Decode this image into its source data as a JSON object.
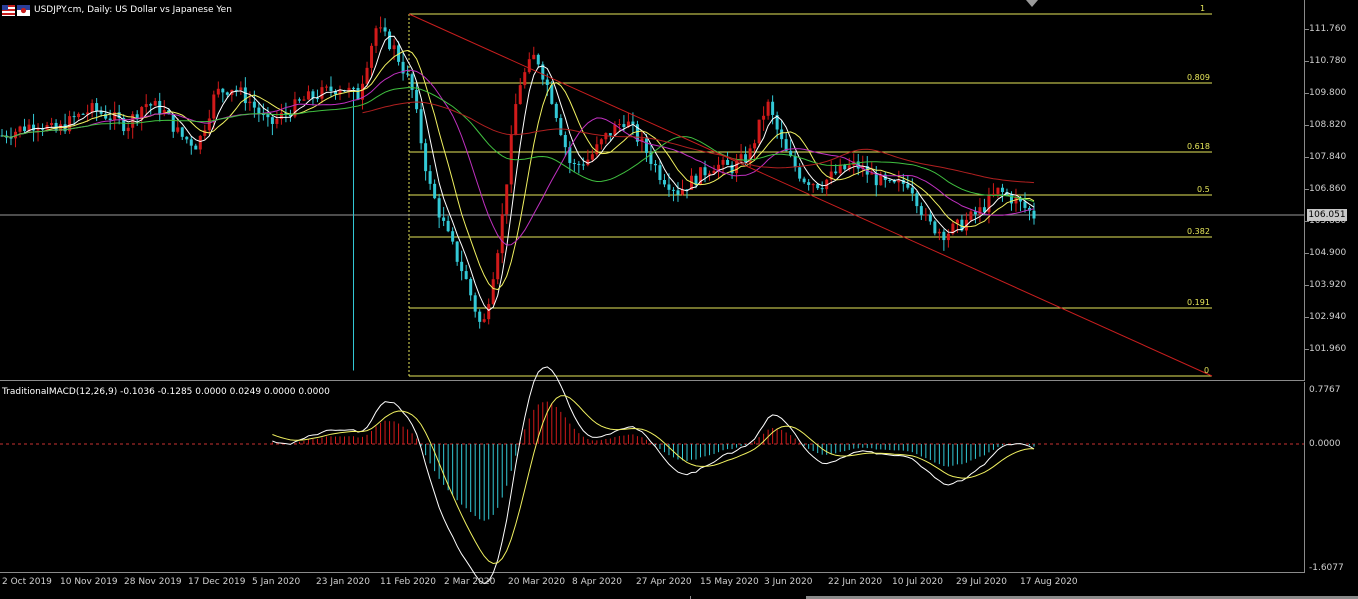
{
  "chart_title": "USDJPY.cm, Daily:  US Dollar vs Japanese Yen",
  "macd_title": "TraditionalMACD(12,26,9) -0.1036 -0.1285 0.0000 0.0249 0.0000 0.0000",
  "current_price": "106.051",
  "price_axis": [
    "111.760",
    "110.780",
    "109.800",
    "108.820",
    "107.840",
    "106.860",
    "105.880",
    "104.900",
    "103.920",
    "102.940",
    "101.960"
  ],
  "macd_axis": {
    "top": "0.7767",
    "zero": "0.0000",
    "bottom": "-1.6077"
  },
  "time_axis": [
    "2 Oct 2019",
    "10 Nov 2019",
    "28 Nov 2019",
    "17 Dec 2019",
    "5 Jan 2020",
    "23 Jan 2020",
    "11 Feb 2020",
    "2 Mar 2020",
    "20 Mar 2020",
    "8 Apr 2020",
    "27 Apr 2020",
    "15 May 2020",
    "3 Jun 2020",
    "22 Jun 2020",
    "10 Jul 2020",
    "29 Jul 2020",
    "17 Aug 2020"
  ],
  "fibo_levels": [
    "1",
    "0.809",
    "0.618",
    "0.5",
    "0.382",
    "0.191",
    "0"
  ],
  "colors": {
    "bull": "#d11a1a",
    "bear": "#33c9d6",
    "fib": "#e6e65a",
    "trend": "#c81e1e",
    "grid": "#8a8a8a",
    "ma_white": "#ffffff",
    "ma_yellow": "#f0f060",
    "ma_green": "#40c040",
    "ma_magenta": "#c030c0",
    "ma_red": "#b02020"
  },
  "icons": {
    "flag": "us-jp-flag-icon",
    "scroll": "chart-shift-marker-icon"
  },
  "chart_data": {
    "type": "candlestick",
    "symbol": "USDJPY.cm",
    "timeframe": "Daily",
    "ylim": [
      101.3,
      112.2
    ],
    "close_approx": [
      108.5,
      108.7,
      108.9,
      108.6,
      109.0,
      109.3,
      109.1,
      108.8,
      109.5,
      109.3,
      108.5,
      108.2,
      109.8,
      110.0,
      109.5,
      108.8,
      109.2,
      109.6,
      109.8,
      110.0,
      109.7,
      111.8,
      111.2,
      110.0,
      107.0,
      105.5,
      104.2,
      102.5,
      105.5,
      110.0,
      111.0,
      109.5,
      107.5,
      107.8,
      108.5,
      109.0,
      108.2,
      107.3,
      106.8,
      107.2,
      107.6,
      107.5,
      107.9,
      109.5,
      108.0,
      107.2,
      107.0,
      107.4,
      107.6,
      107.2,
      106.9,
      107.1,
      105.8,
      105.5,
      105.8,
      106.2,
      106.8,
      106.5,
      106.051
    ],
    "fibonacci": {
      "high": 111.9,
      "low": 101.2
    },
    "macd": {
      "ylim": [
        -1.6077,
        0.7767
      ]
    }
  }
}
